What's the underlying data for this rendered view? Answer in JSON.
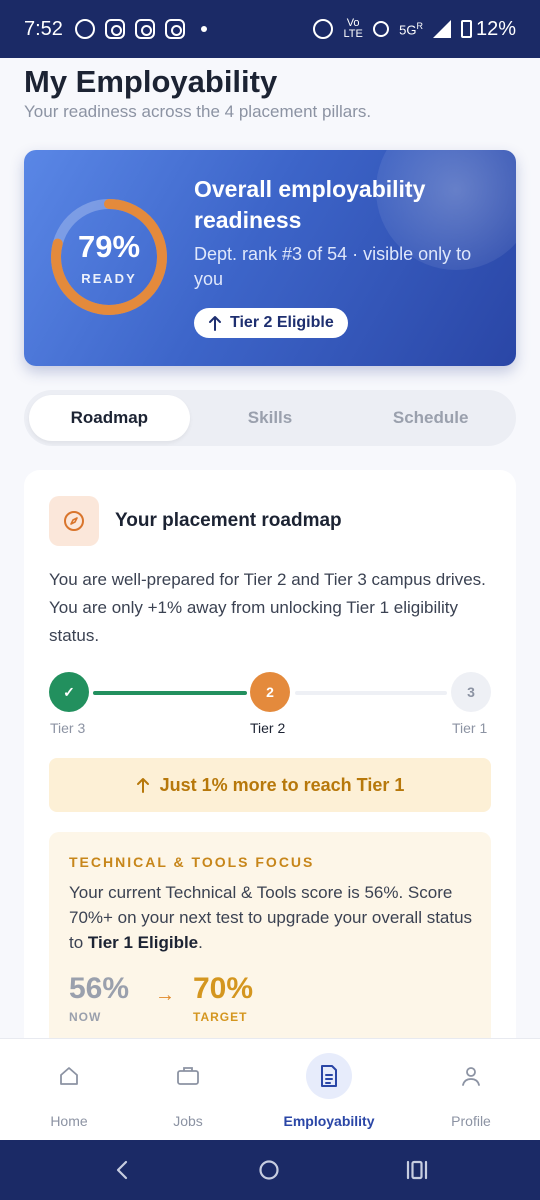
{
  "status_bar": {
    "time": "7:52",
    "network": "5G",
    "network_sup": "R",
    "volte": "Vo LTE",
    "battery": "12%"
  },
  "page": {
    "title": "My Employability",
    "subtitle": "Your readiness across the 4 placement pillars."
  },
  "hero": {
    "percent_label": "79%",
    "percent_value": 0.79,
    "ready_label": "READY",
    "title": "Overall employability readiness",
    "subtitle": "Dept. rank #3 of 54 · visible only to you",
    "badge": "Tier 2 Eligible"
  },
  "tabs": [
    {
      "label": "Roadmap",
      "active": true
    },
    {
      "label": "Skills",
      "active": false
    },
    {
      "label": "Schedule",
      "active": false
    }
  ],
  "roadmap": {
    "title": "Your placement roadmap",
    "description": "You are well-prepared for Tier 2 and Tier 3 campus drives. You are only +1% away from unlocking Tier 1 eligibility status.",
    "steps": [
      {
        "label": "Tier 3",
        "marker": "✓",
        "state": "done"
      },
      {
        "label": "Tier 2",
        "marker": "2",
        "state": "current"
      },
      {
        "label": "Tier 1",
        "marker": "3",
        "state": "upcoming"
      }
    ],
    "banner": "Just 1% more to reach Tier 1"
  },
  "focus": {
    "title": "TECHNICAL & TOOLS FOCUS",
    "desc_before": "Your current Technical & Tools score is 56%. Score 70%+ on your next test to upgrade your overall status to ",
    "desc_bold": "Tier 1 Eligible",
    "desc_after": ".",
    "now_value": "56%",
    "now_label": "NOW",
    "target_value": "70%",
    "target_label": "TARGET"
  },
  "bottom_nav": [
    {
      "label": "Home",
      "icon": "home-icon",
      "active": false
    },
    {
      "label": "Jobs",
      "icon": "briefcase-icon",
      "active": false
    },
    {
      "label": "Employability",
      "icon": "document-icon",
      "active": true
    },
    {
      "label": "Profile",
      "icon": "person-icon",
      "active": false
    }
  ],
  "colors": {
    "accent": "#2a46a6",
    "success": "#22905e",
    "warning": "#e0892a",
    "gold": "#d4961f"
  }
}
